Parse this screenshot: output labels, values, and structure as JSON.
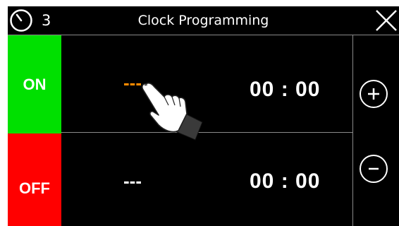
{
  "header": {
    "clock_count": "3",
    "title": "Clock Programming",
    "icons": {
      "clock": "clock-icon",
      "close": "close-icon"
    }
  },
  "schedule": [
    {
      "state_label": "ON",
      "state_color": "#00e000",
      "day": "---",
      "day_color": "#ff8a00",
      "time": "00 : 00"
    },
    {
      "state_label": "OFF",
      "state_color": "#ff0000",
      "day": "---",
      "day_color": "#ffffff",
      "time": "00 : 00"
    }
  ],
  "controls": {
    "increment_icon": "plus-icon",
    "decrement_icon": "minus-icon"
  },
  "overlay": {
    "pointer_icon": "pointing-hand-icon"
  }
}
